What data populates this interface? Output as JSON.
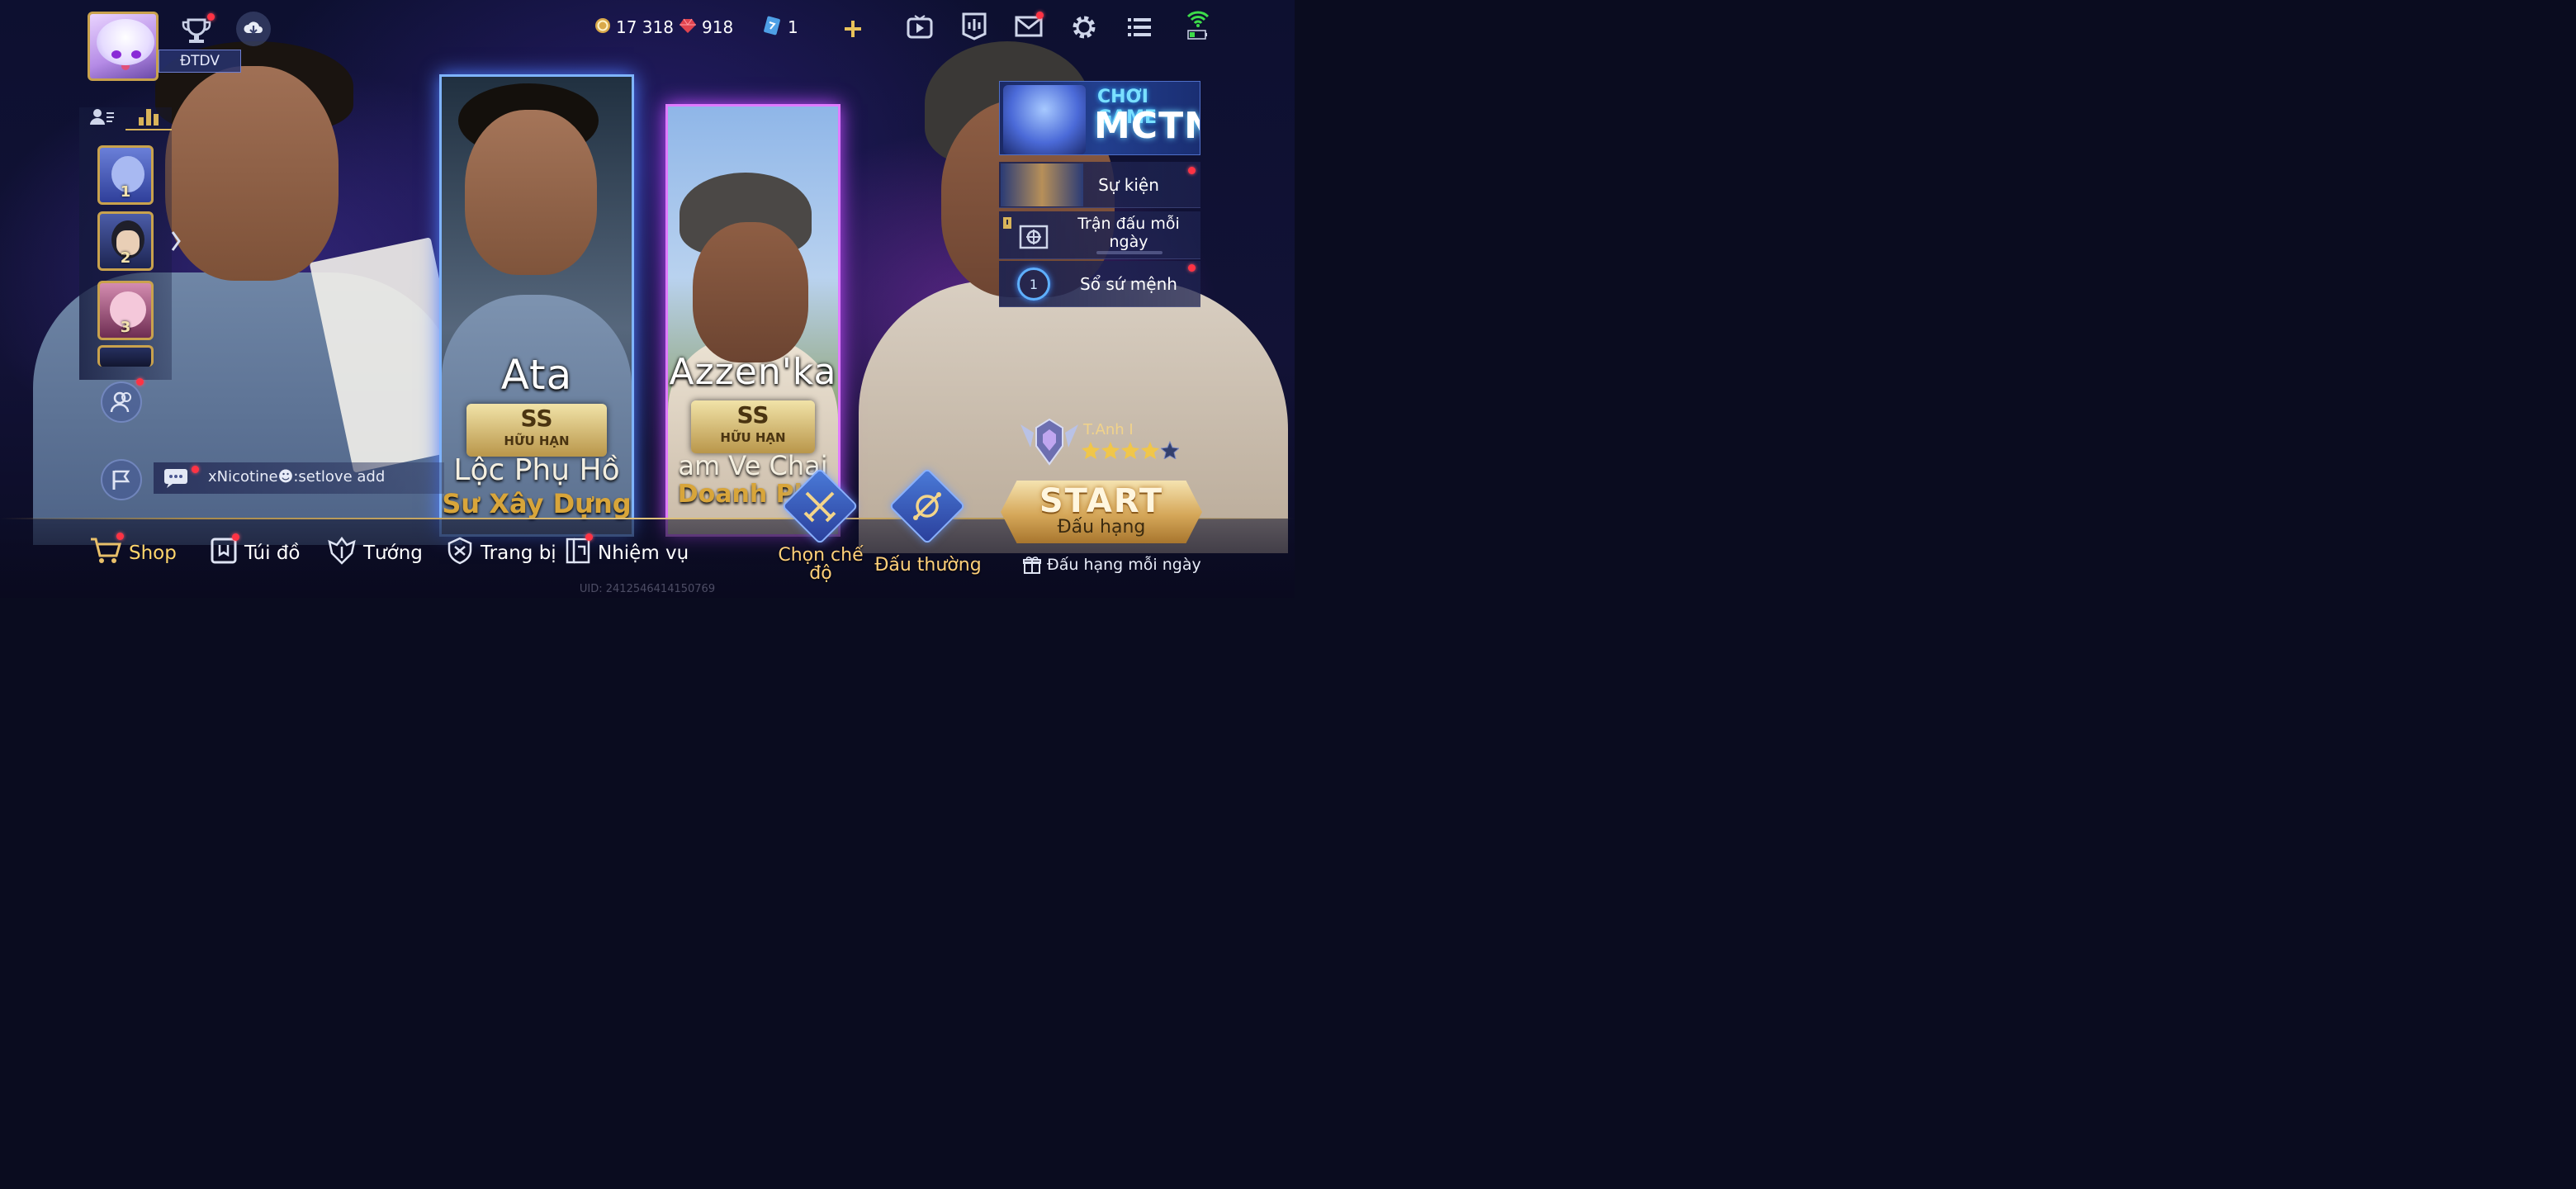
{
  "top": {
    "rank_tag": "ĐTDV",
    "gold": "17 318",
    "gems": "918",
    "tickets": "1"
  },
  "chat": {
    "text": "xNicotine☻:setlove add"
  },
  "cards": [
    {
      "name": "Ata",
      "tier": "SS",
      "tier_sub": "HỮU HẠN",
      "line1": "Lộc Phụ Hồ",
      "line2": "Sư Xây Dựng"
    },
    {
      "name": "Azzen'ka",
      "tier": "SS",
      "tier_sub": "HỮU HẠN",
      "line1": "am Ve Chai",
      "line2": "Doanh Phá"
    }
  ],
  "rail": {
    "slots": [
      "1",
      "2",
      "3"
    ]
  },
  "events": {
    "banner_line1": "CHƠI GAME",
    "banner_line2": "MCTN",
    "items": [
      "Sự kiện",
      "Trận đấu mỗi ngày",
      "Sổ sứ mệnh"
    ],
    "mission_count": "1"
  },
  "nav": {
    "shop": "Shop",
    "bag": "Túi đồ",
    "heroes": "Tướng",
    "gear": "Trang bị",
    "missions": "Nhiệm vụ"
  },
  "modes": {
    "choose": "Chọn chế độ",
    "normal": "Đấu thường"
  },
  "rank": {
    "player": "T.Anh I",
    "stars_filled": 4,
    "stars_total": 5,
    "start": "START",
    "start_sub": "Đấu hạng",
    "daily": "Đấu hạng mỗi ngày"
  },
  "footer": {
    "uid": "UID: 2412546414150769"
  },
  "colors": {
    "gold": "#d9b45a",
    "red_dot": "#ff3344",
    "signal": "#3ddc4a"
  }
}
